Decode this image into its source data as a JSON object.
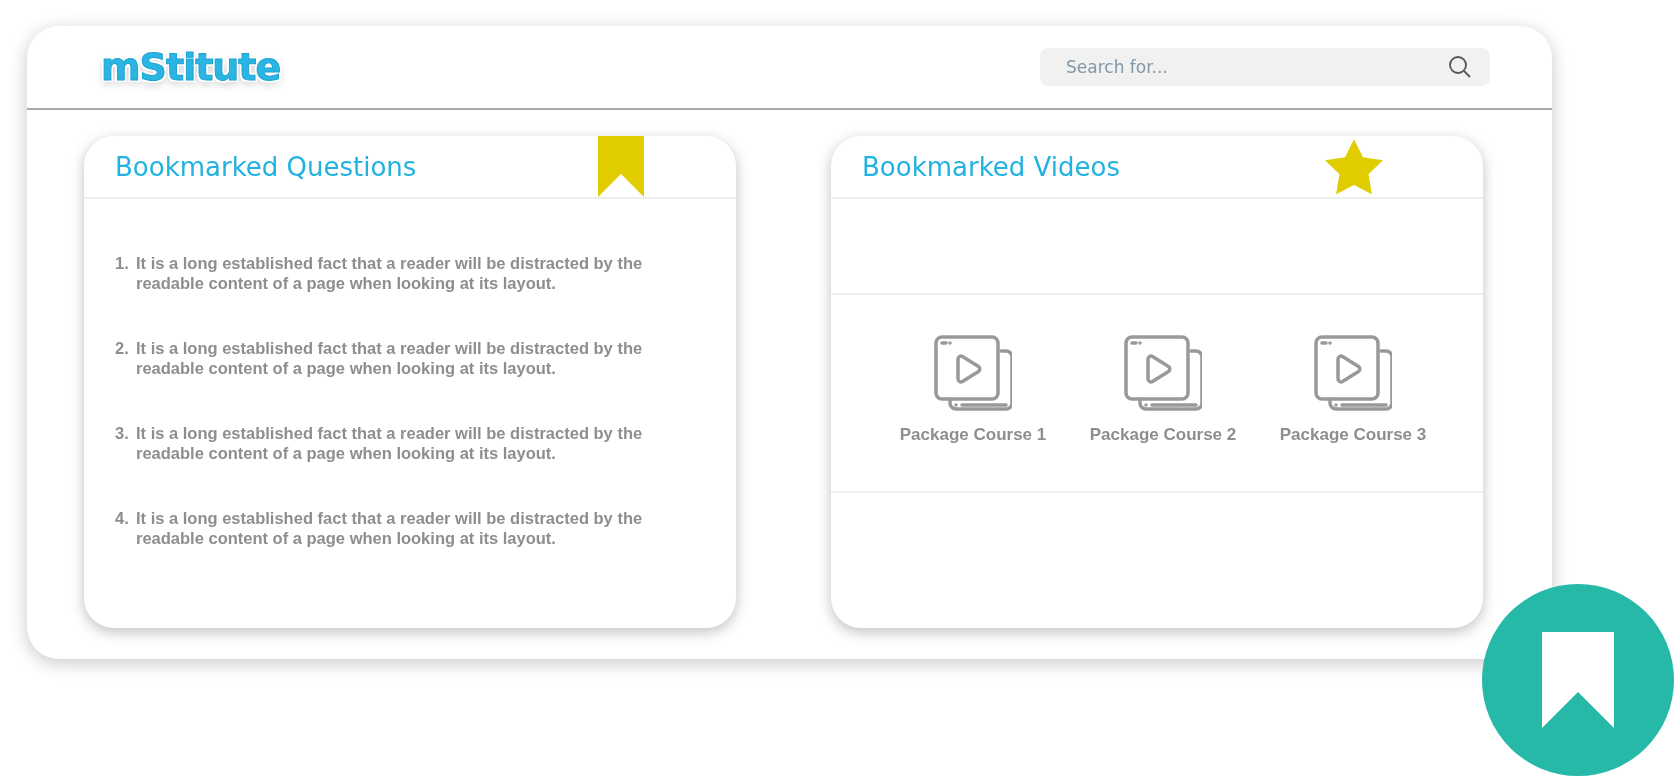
{
  "header": {
    "logo": "mStitute",
    "search": {
      "placeholder": "Search for..."
    }
  },
  "questions_panel": {
    "title": "Bookmarked Questions",
    "items": [
      {
        "number": "1.",
        "text": "It is a long established fact that a reader will be distracted by the readable content of a page when looking at its layout."
      },
      {
        "number": "2.",
        "text": "It is a long established fact that a reader will be distracted by the readable content of a page when looking at its layout."
      },
      {
        "number": "3.",
        "text": "It is a long established fact that a reader will be distracted by the readable content of a page when looking at its layout."
      },
      {
        "number": "4.",
        "text": "It is a long established fact that a reader will be distracted by the readable content of a page when looking at its layout."
      }
    ]
  },
  "videos_panel": {
    "title": "Bookmarked Videos",
    "courses": [
      {
        "label": "Package Course 1"
      },
      {
        "label": "Package Course 2"
      },
      {
        "label": "Package Course 3"
      }
    ]
  }
}
